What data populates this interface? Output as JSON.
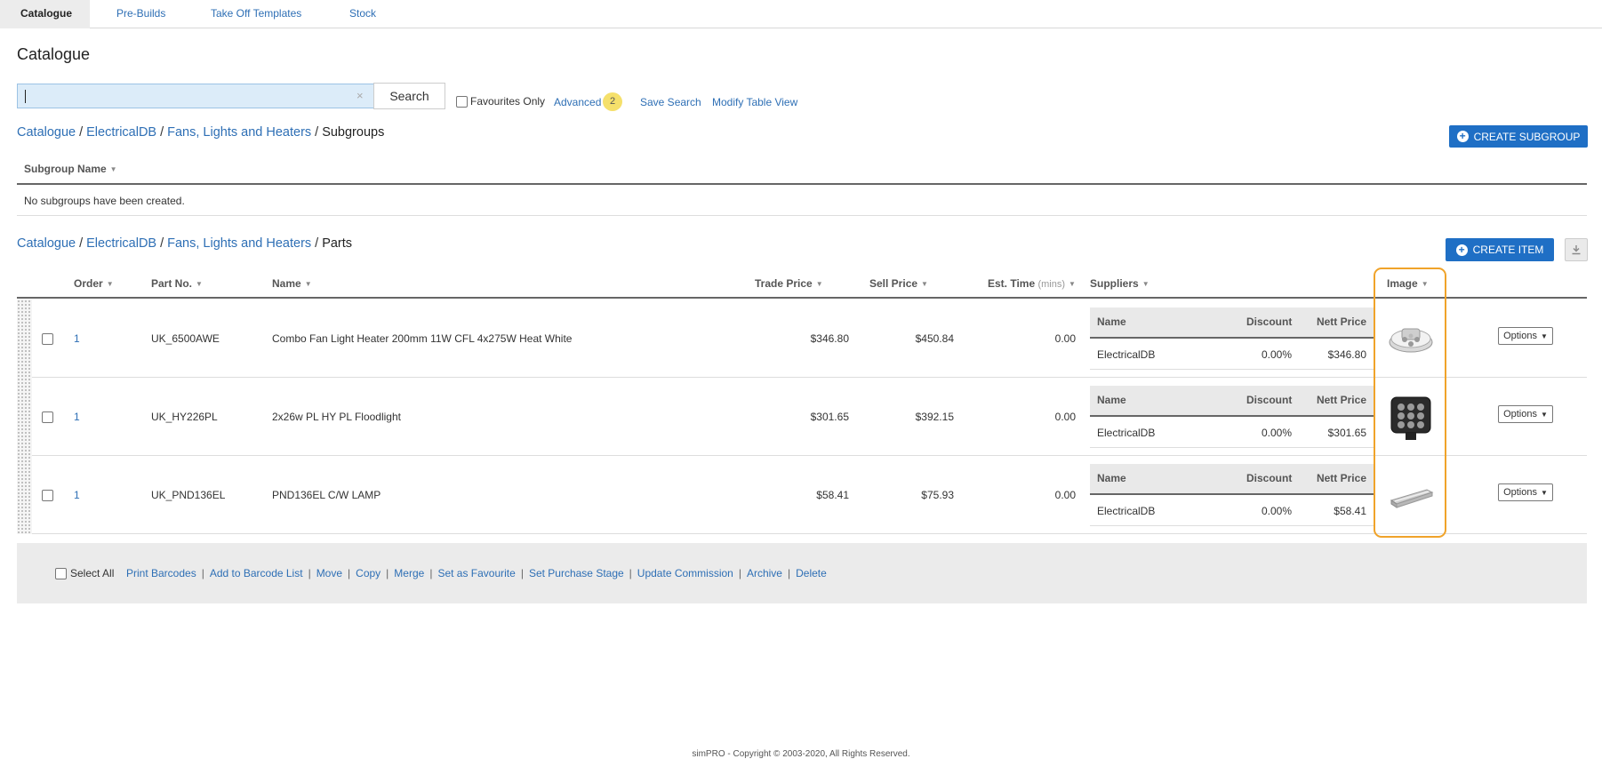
{
  "tabs": [
    {
      "label": "Catalogue"
    },
    {
      "label": "Pre-Builds"
    },
    {
      "label": "Take Off Templates"
    },
    {
      "label": "Stock"
    }
  ],
  "page_title": "Catalogue",
  "search": {
    "value": "",
    "clear_glyph": "×",
    "button_label": "Search",
    "favourites_label": "Favourites Only",
    "advanced_label": "Advanced",
    "advanced_count": "2",
    "save_search_label": "Save Search",
    "modify_view_label": "Modify Table View"
  },
  "subgroups": {
    "breadcrumb": [
      "Catalogue",
      "ElectricalDB",
      "Fans, Lights and Heaters"
    ],
    "breadcrumb_current": "Subgroups",
    "create_button": "CREATE SUBGROUP",
    "column_header": "Subgroup Name",
    "empty_message": "No subgroups have been created."
  },
  "parts": {
    "breadcrumb": [
      "Catalogue",
      "ElectricalDB",
      "Fans, Lights and Heaters"
    ],
    "breadcrumb_current": "Parts",
    "create_button": "CREATE ITEM",
    "download_icon": "download-icon",
    "columns": {
      "order": "Order",
      "part_no": "Part No.",
      "name": "Name",
      "trade_price": "Trade Price",
      "sell_price": "Sell Price",
      "est_time": "Est. Time",
      "est_time_unit": "(mins)",
      "suppliers": "Suppliers",
      "image": "Image"
    },
    "supplier_columns": {
      "name": "Name",
      "discount": "Discount",
      "nett_price": "Nett Price"
    },
    "options_label": "Options",
    "rows": [
      {
        "order": "1",
        "part_no": "UK_6500AWE",
        "name": "Combo Fan Light Heater 200mm 11W CFL 4x275W Heat White",
        "trade_price": "$346.80",
        "sell_price": "$450.84",
        "est_time": "0.00",
        "supplier": {
          "name": "ElectricalDB",
          "discount": "0.00%",
          "nett_price": "$346.80"
        },
        "image": "fan-light-heater-image"
      },
      {
        "order": "1",
        "part_no": "UK_HY226PL",
        "name": "2x26w PL HY PL Floodlight",
        "trade_price": "$301.65",
        "sell_price": "$392.15",
        "est_time": "0.00",
        "supplier": {
          "name": "ElectricalDB",
          "discount": "0.00%",
          "nett_price": "$301.65"
        },
        "image": "floodlight-image"
      },
      {
        "order": "1",
        "part_no": "UK_PND136EL",
        "name": "PND136EL C/W LAMP",
        "trade_price": "$58.41",
        "sell_price": "$75.93",
        "est_time": "0.00",
        "supplier": {
          "name": "ElectricalDB",
          "discount": "0.00%",
          "nett_price": "$58.41"
        },
        "image": "batten-lamp-image"
      }
    ]
  },
  "actions": {
    "select_all": "Select All",
    "items": [
      "Print Barcodes",
      "Add to Barcode List",
      "Move",
      "Copy",
      "Merge",
      "Set as Favourite",
      "Set Purchase Stage",
      "Update Commission",
      "Archive",
      "Delete"
    ]
  },
  "footer": "simPRO - Copyright © 2003-2020, All Rights Reserved.",
  "colors": {
    "accent": "#1f6fc5",
    "link": "#2e6fb5",
    "highlight": "#f0a32a",
    "badge": "#f5e06b"
  }
}
